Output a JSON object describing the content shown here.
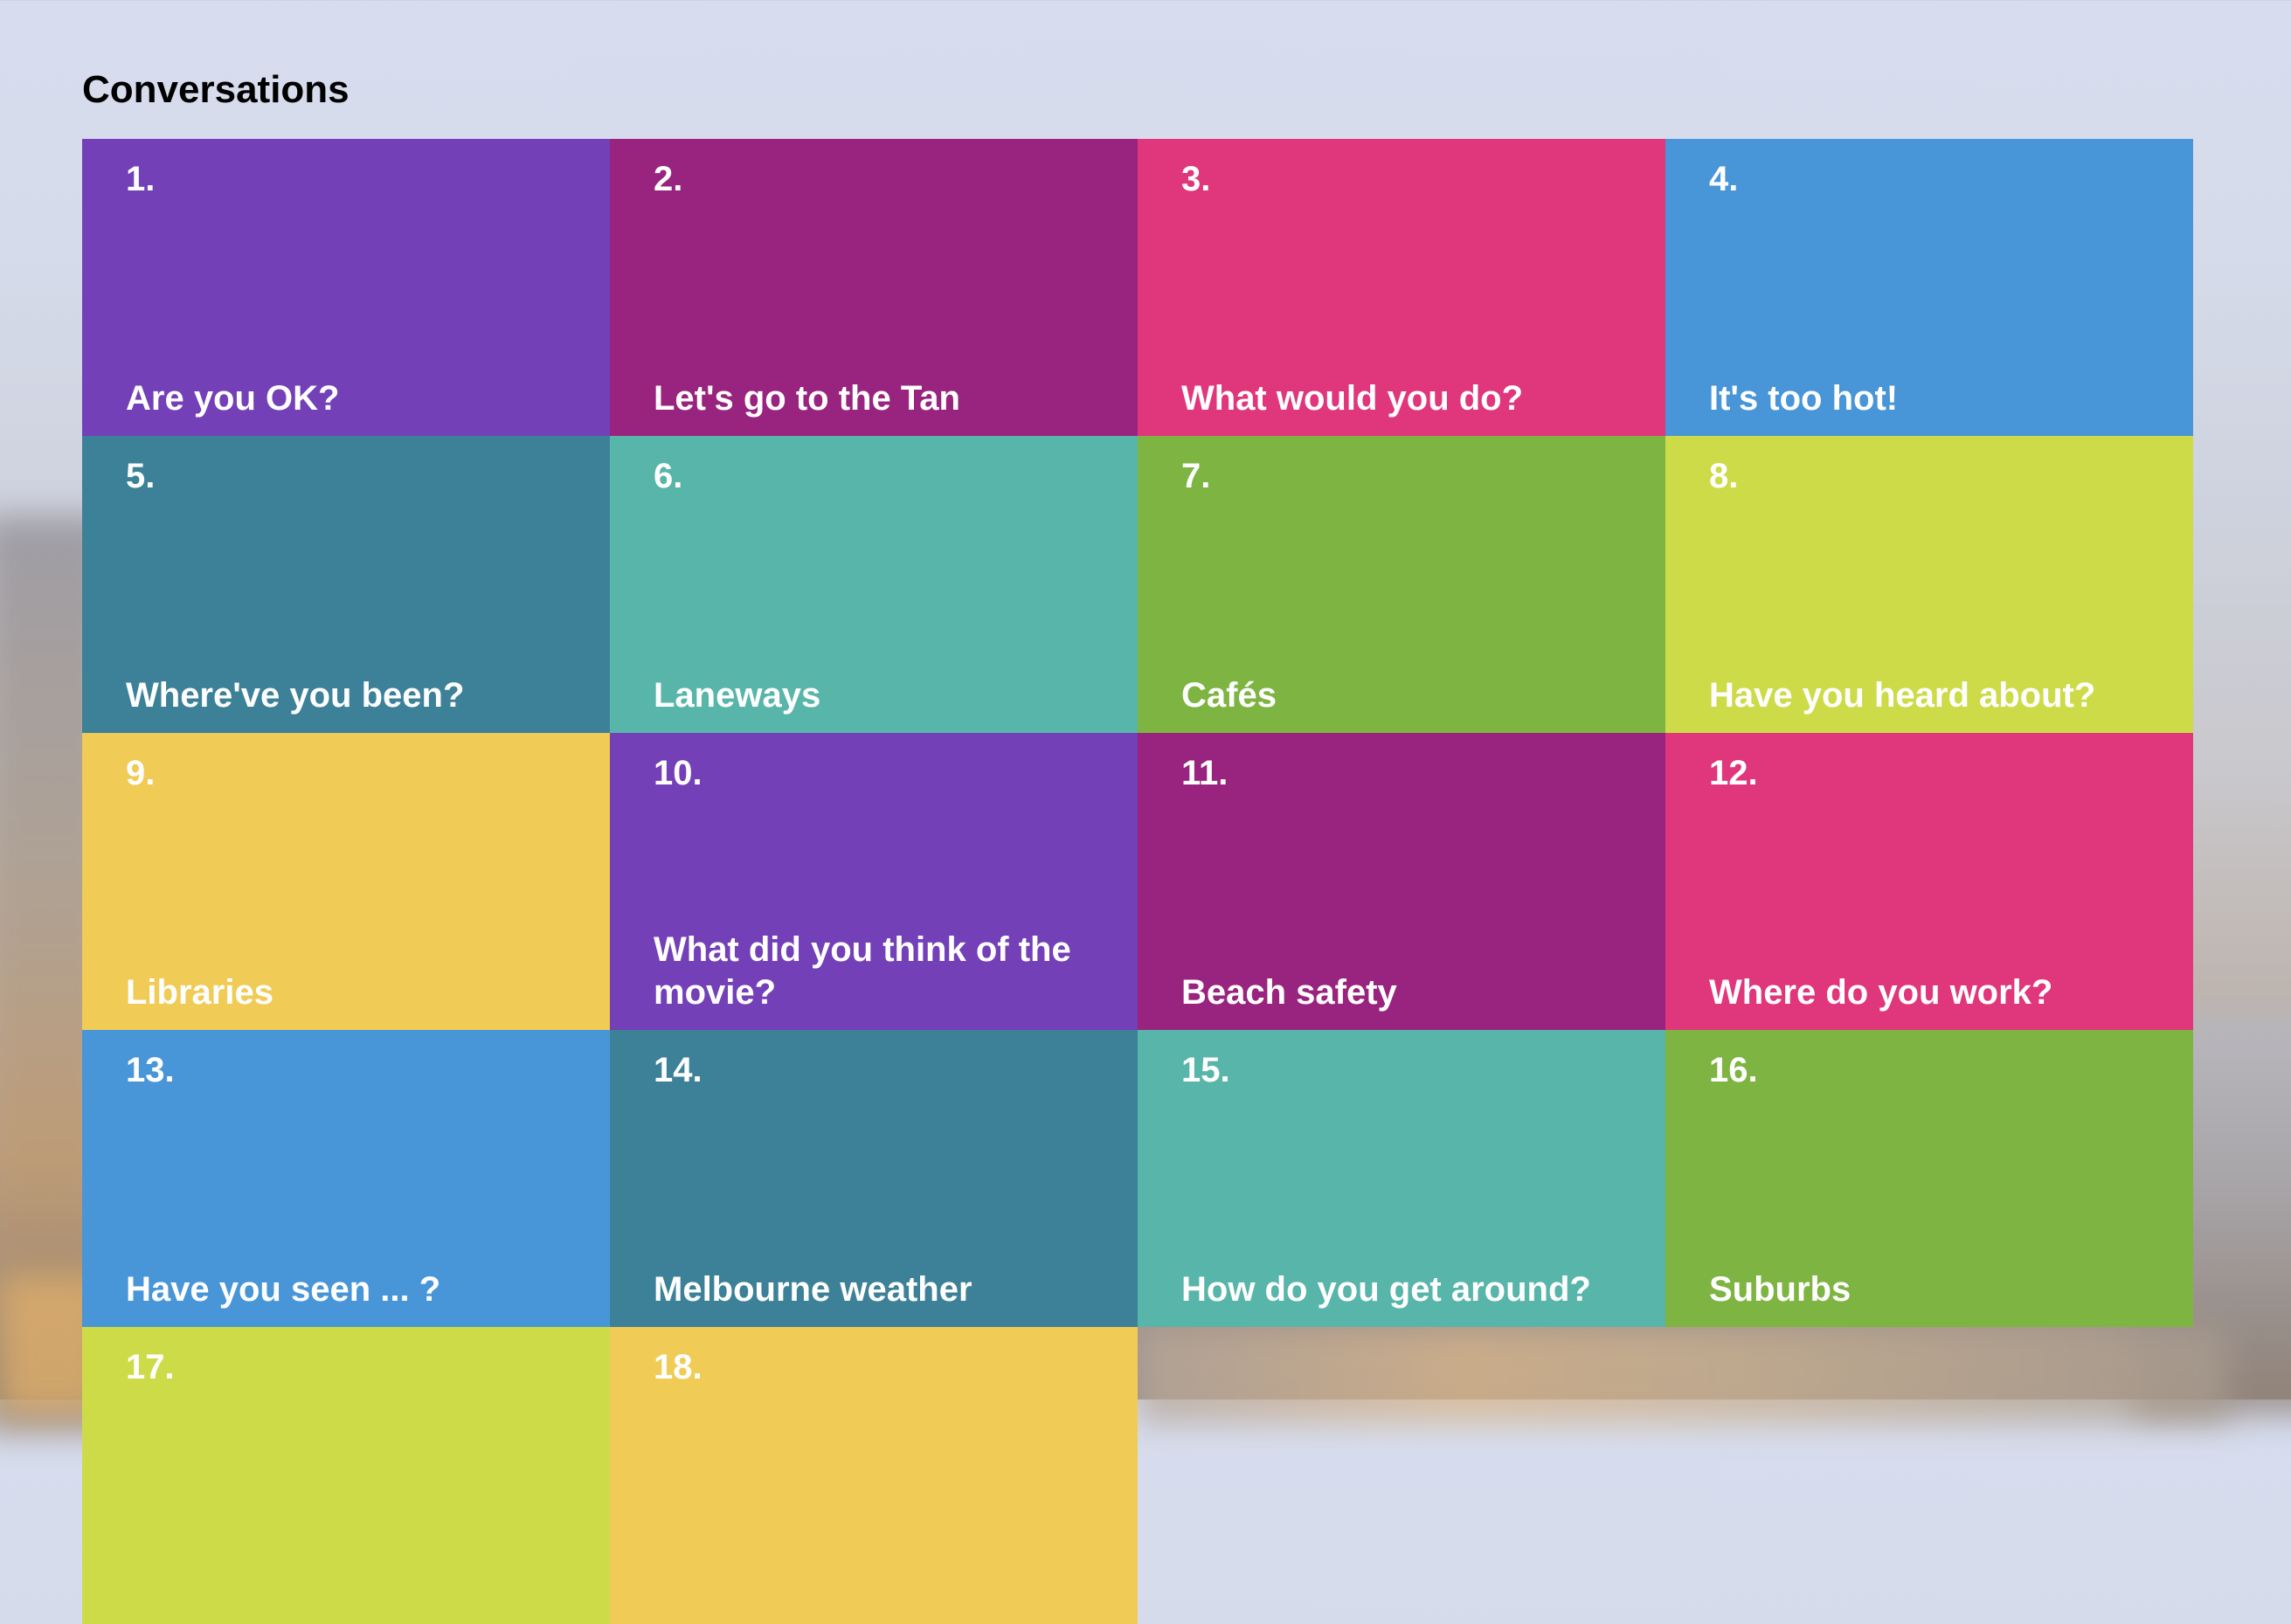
{
  "page": {
    "heading": "Conversations"
  },
  "colors": {
    "purple": "#7340b8",
    "magenta": "#98247f",
    "pink": "#e0367c",
    "blue": "#4896d7",
    "teal": "#3d8199",
    "aqua": "#58b5a9",
    "green": "#7db442",
    "lime": "#cedb48",
    "yellow": "#f0cb55"
  },
  "tiles": [
    {
      "number": "1.",
      "title": "Are you OK?",
      "color": "#7340b8"
    },
    {
      "number": "2.",
      "title": "Let's go to the Tan",
      "color": "#98247f"
    },
    {
      "number": "3.",
      "title": "What would you do?",
      "color": "#e0367c"
    },
    {
      "number": "4.",
      "title": "It's too hot!",
      "color": "#4896d7"
    },
    {
      "number": "5.",
      "title": "Where've you been?",
      "color": "#3d8199"
    },
    {
      "number": "6.",
      "title": "Laneways",
      "color": "#58b5a9"
    },
    {
      "number": "7.",
      "title": "Cafés",
      "color": "#7db442"
    },
    {
      "number": "8.",
      "title": "Have you heard about?",
      "color": "#cedb48"
    },
    {
      "number": "9.",
      "title": "Libraries",
      "color": "#f0cb55"
    },
    {
      "number": "10.",
      "title": "What did you think of the movie?",
      "color": "#7340b8"
    },
    {
      "number": "11.",
      "title": "Beach safety",
      "color": "#98247f"
    },
    {
      "number": "12.",
      "title": "Where do you work?",
      "color": "#e0367c"
    },
    {
      "number": "13.",
      "title": "Have you seen ... ?",
      "color": "#4896d7"
    },
    {
      "number": "14.",
      "title": "Melbourne weather",
      "color": "#3d8199"
    },
    {
      "number": "15.",
      "title": "How do you get around?",
      "color": "#58b5a9"
    },
    {
      "number": "16.",
      "title": "Suburbs",
      "color": "#7db442"
    },
    {
      "number": "17.",
      "title": "",
      "color": "#cedb48"
    },
    {
      "number": "18.",
      "title": "",
      "color": "#f0cb55"
    }
  ]
}
